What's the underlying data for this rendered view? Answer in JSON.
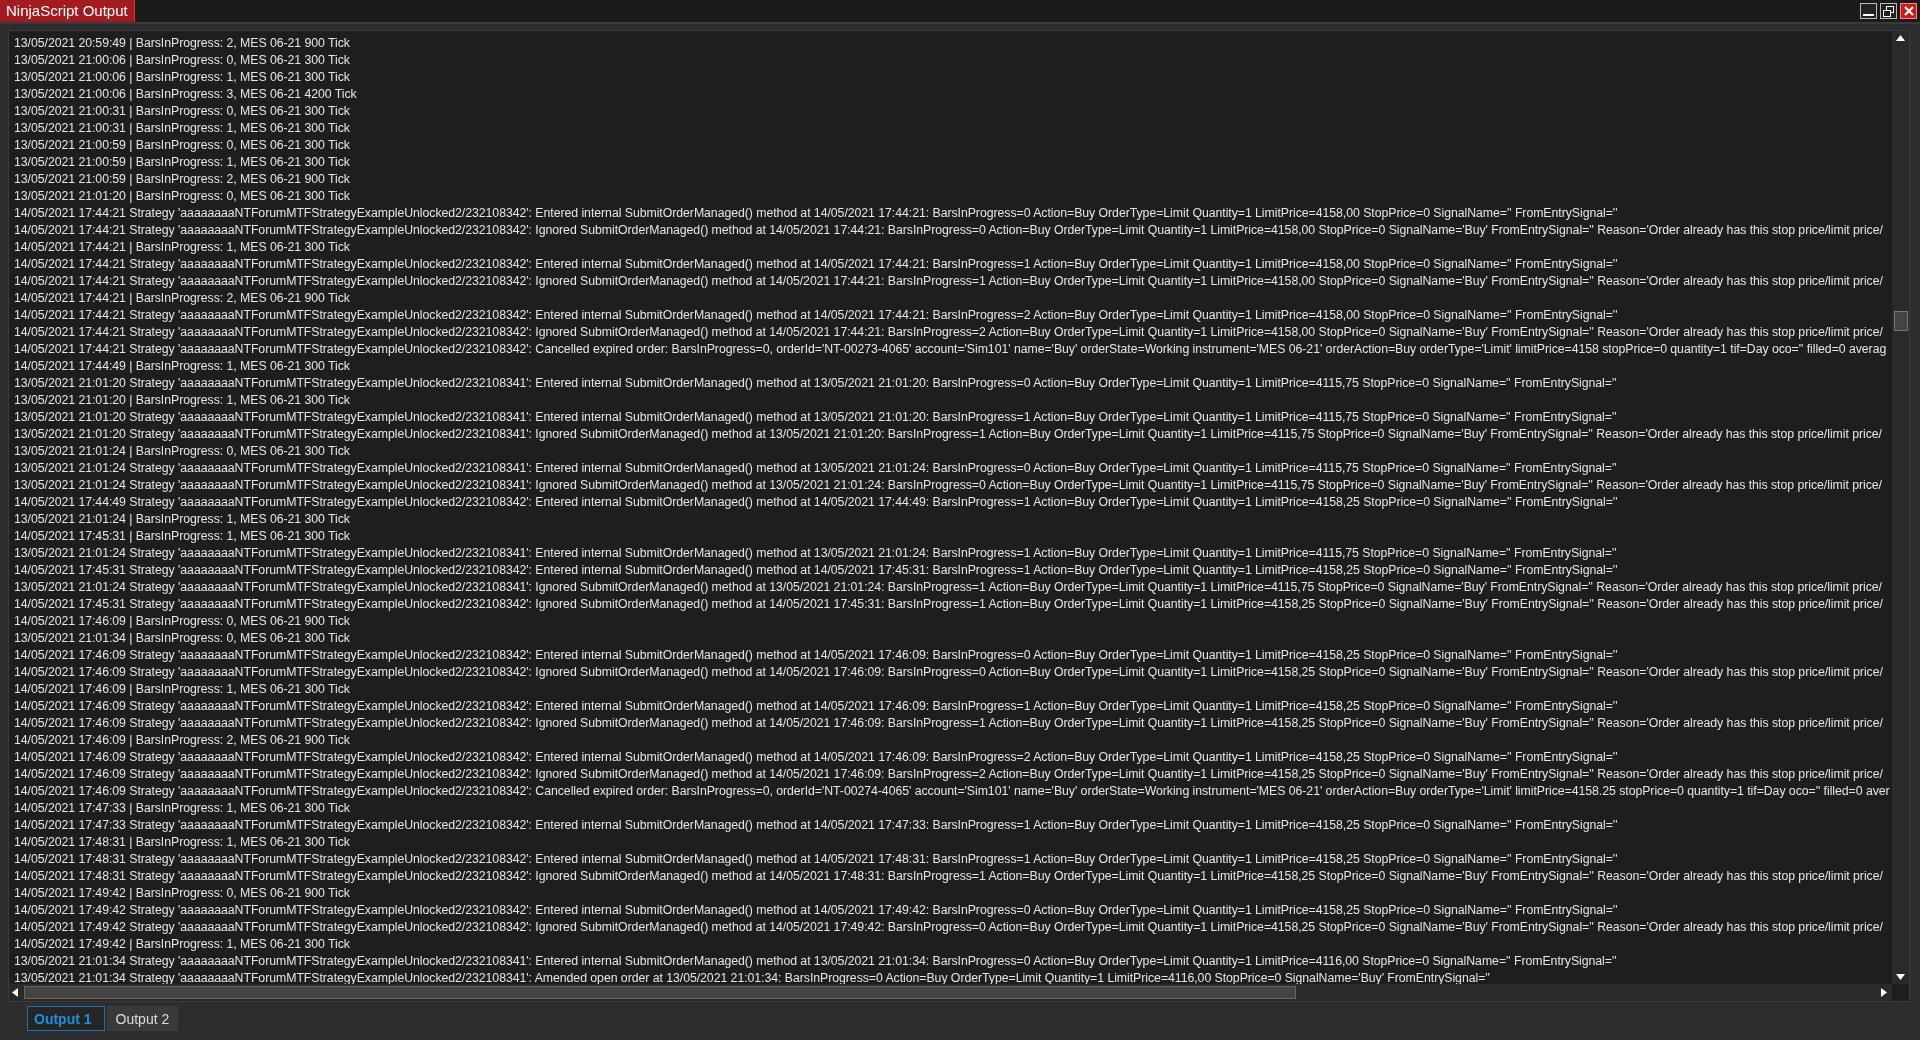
{
  "window": {
    "title": "NinjaScript Output"
  },
  "log": {
    "lines": [
      "13/05/2021 20:59:49 | BarsInProgress: 2, MES 06-21 900 Tick",
      "13/05/2021 21:00:06 | BarsInProgress: 0, MES 06-21 300 Tick",
      "13/05/2021 21:00:06 | BarsInProgress: 1, MES 06-21 300 Tick",
      "13/05/2021 21:00:06 | BarsInProgress: 3, MES 06-21 4200 Tick",
      "13/05/2021 21:00:31 | BarsInProgress: 0, MES 06-21 300 Tick",
      "13/05/2021 21:00:31 | BarsInProgress: 1, MES 06-21 300 Tick",
      "13/05/2021 21:00:59 | BarsInProgress: 0, MES 06-21 300 Tick",
      "13/05/2021 21:00:59 | BarsInProgress: 1, MES 06-21 300 Tick",
      "13/05/2021 21:00:59 | BarsInProgress: 2, MES 06-21 900 Tick",
      "13/05/2021 21:01:20 | BarsInProgress: 0, MES 06-21 300 Tick",
      "14/05/2021 17:44:21 Strategy 'aaaaaaaaNTForumMTFStrategyExampleUnlocked2/232108342': Entered internal SubmitOrderManaged() method at 14/05/2021 17:44:21: BarsInProgress=0 Action=Buy OrderType=Limit Quantity=1 LimitPrice=4158,00 StopPrice=0 SignalName='' FromEntrySignal=''",
      "14/05/2021 17:44:21 Strategy 'aaaaaaaaNTForumMTFStrategyExampleUnlocked2/232108342': Ignored SubmitOrderManaged() method at 14/05/2021 17:44:21: BarsInProgress=0 Action=Buy OrderType=Limit Quantity=1 LimitPrice=4158,00 StopPrice=0 SignalName='Buy' FromEntrySignal='' Reason='Order already has this stop price/limit price/",
      "14/05/2021 17:44:21 | BarsInProgress: 1, MES 06-21 300 Tick",
      "14/05/2021 17:44:21 Strategy 'aaaaaaaaNTForumMTFStrategyExampleUnlocked2/232108342': Entered internal SubmitOrderManaged() method at 14/05/2021 17:44:21: BarsInProgress=1 Action=Buy OrderType=Limit Quantity=1 LimitPrice=4158,00 StopPrice=0 SignalName='' FromEntrySignal=''",
      "14/05/2021 17:44:21 Strategy 'aaaaaaaaNTForumMTFStrategyExampleUnlocked2/232108342': Ignored SubmitOrderManaged() method at 14/05/2021 17:44:21: BarsInProgress=1 Action=Buy OrderType=Limit Quantity=1 LimitPrice=4158,00 StopPrice=0 SignalName='Buy' FromEntrySignal='' Reason='Order already has this stop price/limit price/",
      "14/05/2021 17:44:21 | BarsInProgress: 2, MES 06-21 900 Tick",
      "14/05/2021 17:44:21 Strategy 'aaaaaaaaNTForumMTFStrategyExampleUnlocked2/232108342': Entered internal SubmitOrderManaged() method at 14/05/2021 17:44:21: BarsInProgress=2 Action=Buy OrderType=Limit Quantity=1 LimitPrice=4158,00 StopPrice=0 SignalName='' FromEntrySignal=''",
      "14/05/2021 17:44:21 Strategy 'aaaaaaaaNTForumMTFStrategyExampleUnlocked2/232108342': Ignored SubmitOrderManaged() method at 14/05/2021 17:44:21: BarsInProgress=2 Action=Buy OrderType=Limit Quantity=1 LimitPrice=4158,00 StopPrice=0 SignalName='Buy' FromEntrySignal='' Reason='Order already has this stop price/limit price/",
      "14/05/2021 17:44:21 Strategy 'aaaaaaaaNTForumMTFStrategyExampleUnlocked2/232108342': Cancelled expired order: BarsInProgress=0, orderId='NT-00273-4065' account='Sim101' name='Buy' orderState=Working instrument='MES 06-21' orderAction=Buy orderType='Limit' limitPrice=4158 stopPrice=0 quantity=1 tif=Day oco='' filled=0 averag",
      "14/05/2021 17:44:49 | BarsInProgress: 1, MES 06-21 300 Tick",
      "13/05/2021 21:01:20 Strategy 'aaaaaaaaNTForumMTFStrategyExampleUnlocked2/232108341': Entered internal SubmitOrderManaged() method at 13/05/2021 21:01:20: BarsInProgress=0 Action=Buy OrderType=Limit Quantity=1 LimitPrice=4115,75 StopPrice=0 SignalName='' FromEntrySignal=''",
      "13/05/2021 21:01:20 | BarsInProgress: 1, MES 06-21 300 Tick",
      "13/05/2021 21:01:20 Strategy 'aaaaaaaaNTForumMTFStrategyExampleUnlocked2/232108341': Entered internal SubmitOrderManaged() method at 13/05/2021 21:01:20: BarsInProgress=1 Action=Buy OrderType=Limit Quantity=1 LimitPrice=4115,75 StopPrice=0 SignalName='' FromEntrySignal=''",
      "13/05/2021 21:01:20 Strategy 'aaaaaaaaNTForumMTFStrategyExampleUnlocked2/232108341': Ignored SubmitOrderManaged() method at 13/05/2021 21:01:20: BarsInProgress=1 Action=Buy OrderType=Limit Quantity=1 LimitPrice=4115,75 StopPrice=0 SignalName='Buy' FromEntrySignal='' Reason='Order already has this stop price/limit price/",
      "13/05/2021 21:01:24 | BarsInProgress: 0, MES 06-21 300 Tick",
      "13/05/2021 21:01:24 Strategy 'aaaaaaaaNTForumMTFStrategyExampleUnlocked2/232108341': Entered internal SubmitOrderManaged() method at 13/05/2021 21:01:24: BarsInProgress=0 Action=Buy OrderType=Limit Quantity=1 LimitPrice=4115,75 StopPrice=0 SignalName='' FromEntrySignal=''",
      "13/05/2021 21:01:24 Strategy 'aaaaaaaaNTForumMTFStrategyExampleUnlocked2/232108341': Ignored SubmitOrderManaged() method at 13/05/2021 21:01:24: BarsInProgress=0 Action=Buy OrderType=Limit Quantity=1 LimitPrice=4115,75 StopPrice=0 SignalName='Buy' FromEntrySignal='' Reason='Order already has this stop price/limit price/",
      "14/05/2021 17:44:49 Strategy 'aaaaaaaaNTForumMTFStrategyExampleUnlocked2/232108342': Entered internal SubmitOrderManaged() method at 14/05/2021 17:44:49: BarsInProgress=1 Action=Buy OrderType=Limit Quantity=1 LimitPrice=4158,25 StopPrice=0 SignalName='' FromEntrySignal=''",
      "13/05/2021 21:01:24 | BarsInProgress: 1, MES 06-21 300 Tick",
      "14/05/2021 17:45:31 | BarsInProgress: 1, MES 06-21 300 Tick",
      "13/05/2021 21:01:24 Strategy 'aaaaaaaaNTForumMTFStrategyExampleUnlocked2/232108341': Entered internal SubmitOrderManaged() method at 13/05/2021 21:01:24: BarsInProgress=1 Action=Buy OrderType=Limit Quantity=1 LimitPrice=4115,75 StopPrice=0 SignalName='' FromEntrySignal=''",
      "14/05/2021 17:45:31 Strategy 'aaaaaaaaNTForumMTFStrategyExampleUnlocked2/232108342': Entered internal SubmitOrderManaged() method at 14/05/2021 17:45:31: BarsInProgress=1 Action=Buy OrderType=Limit Quantity=1 LimitPrice=4158,25 StopPrice=0 SignalName='' FromEntrySignal=''",
      "13/05/2021 21:01:24 Strategy 'aaaaaaaaNTForumMTFStrategyExampleUnlocked2/232108341': Ignored SubmitOrderManaged() method at 13/05/2021 21:01:24: BarsInProgress=1 Action=Buy OrderType=Limit Quantity=1 LimitPrice=4115,75 StopPrice=0 SignalName='Buy' FromEntrySignal='' Reason='Order already has this stop price/limit price/",
      "14/05/2021 17:45:31 Strategy 'aaaaaaaaNTForumMTFStrategyExampleUnlocked2/232108342': Ignored SubmitOrderManaged() method at 14/05/2021 17:45:31: BarsInProgress=1 Action=Buy OrderType=Limit Quantity=1 LimitPrice=4158,25 StopPrice=0 SignalName='Buy' FromEntrySignal='' Reason='Order already has this stop price/limit price/",
      "14/05/2021 17:46:09 | BarsInProgress: 0, MES 06-21 900 Tick",
      "13/05/2021 21:01:34 | BarsInProgress: 0, MES 06-21 300 Tick",
      "14/05/2021 17:46:09 Strategy 'aaaaaaaaNTForumMTFStrategyExampleUnlocked2/232108342': Entered internal SubmitOrderManaged() method at 14/05/2021 17:46:09: BarsInProgress=0 Action=Buy OrderType=Limit Quantity=1 LimitPrice=4158,25 StopPrice=0 SignalName='' FromEntrySignal=''",
      "14/05/2021 17:46:09 Strategy 'aaaaaaaaNTForumMTFStrategyExampleUnlocked2/232108342': Ignored SubmitOrderManaged() method at 14/05/2021 17:46:09: BarsInProgress=0 Action=Buy OrderType=Limit Quantity=1 LimitPrice=4158,25 StopPrice=0 SignalName='Buy' FromEntrySignal='' Reason='Order already has this stop price/limit price/",
      "14/05/2021 17:46:09 | BarsInProgress: 1, MES 06-21 300 Tick",
      "14/05/2021 17:46:09 Strategy 'aaaaaaaaNTForumMTFStrategyExampleUnlocked2/232108342': Entered internal SubmitOrderManaged() method at 14/05/2021 17:46:09: BarsInProgress=1 Action=Buy OrderType=Limit Quantity=1 LimitPrice=4158,25 StopPrice=0 SignalName='' FromEntrySignal=''",
      "14/05/2021 17:46:09 Strategy 'aaaaaaaaNTForumMTFStrategyExampleUnlocked2/232108342': Ignored SubmitOrderManaged() method at 14/05/2021 17:46:09: BarsInProgress=1 Action=Buy OrderType=Limit Quantity=1 LimitPrice=4158,25 StopPrice=0 SignalName='Buy' FromEntrySignal='' Reason='Order already has this stop price/limit price/",
      "14/05/2021 17:46:09 | BarsInProgress: 2, MES 06-21 900 Tick",
      "14/05/2021 17:46:09 Strategy 'aaaaaaaaNTForumMTFStrategyExampleUnlocked2/232108342': Entered internal SubmitOrderManaged() method at 14/05/2021 17:46:09: BarsInProgress=2 Action=Buy OrderType=Limit Quantity=1 LimitPrice=4158,25 StopPrice=0 SignalName='' FromEntrySignal=''",
      "14/05/2021 17:46:09 Strategy 'aaaaaaaaNTForumMTFStrategyExampleUnlocked2/232108342': Ignored SubmitOrderManaged() method at 14/05/2021 17:46:09: BarsInProgress=2 Action=Buy OrderType=Limit Quantity=1 LimitPrice=4158,25 StopPrice=0 SignalName='Buy' FromEntrySignal='' Reason='Order already has this stop price/limit price/",
      "14/05/2021 17:46:09 Strategy 'aaaaaaaaNTForumMTFStrategyExampleUnlocked2/232108342': Cancelled expired order: BarsInProgress=0, orderId='NT-00274-4065' account='Sim101' name='Buy' orderState=Working instrument='MES 06-21' orderAction=Buy orderType='Limit' limitPrice=4158.25 stopPrice=0 quantity=1 tif=Day oco='' filled=0 aver",
      "14/05/2021 17:47:33 | BarsInProgress: 1, MES 06-21 300 Tick",
      "14/05/2021 17:47:33 Strategy 'aaaaaaaaNTForumMTFStrategyExampleUnlocked2/232108342': Entered internal SubmitOrderManaged() method at 14/05/2021 17:47:33: BarsInProgress=1 Action=Buy OrderType=Limit Quantity=1 LimitPrice=4158,25 StopPrice=0 SignalName='' FromEntrySignal=''",
      "14/05/2021 17:48:31 | BarsInProgress: 1, MES 06-21 300 Tick",
      "14/05/2021 17:48:31 Strategy 'aaaaaaaaNTForumMTFStrategyExampleUnlocked2/232108342': Entered internal SubmitOrderManaged() method at 14/05/2021 17:48:31: BarsInProgress=1 Action=Buy OrderType=Limit Quantity=1 LimitPrice=4158,25 StopPrice=0 SignalName='' FromEntrySignal=''",
      "14/05/2021 17:48:31 Strategy 'aaaaaaaaNTForumMTFStrategyExampleUnlocked2/232108342': Ignored SubmitOrderManaged() method at 14/05/2021 17:48:31: BarsInProgress=1 Action=Buy OrderType=Limit Quantity=1 LimitPrice=4158,25 StopPrice=0 SignalName='Buy' FromEntrySignal='' Reason='Order already has this stop price/limit price/",
      "14/05/2021 17:49:42 | BarsInProgress: 0, MES 06-21 900 Tick",
      "14/05/2021 17:49:42 Strategy 'aaaaaaaaNTForumMTFStrategyExampleUnlocked2/232108342': Entered internal SubmitOrderManaged() method at 14/05/2021 17:49:42: BarsInProgress=0 Action=Buy OrderType=Limit Quantity=1 LimitPrice=4158,25 StopPrice=0 SignalName='' FromEntrySignal=''",
      "14/05/2021 17:49:42 Strategy 'aaaaaaaaNTForumMTFStrategyExampleUnlocked2/232108342': Ignored SubmitOrderManaged() method at 14/05/2021 17:49:42: BarsInProgress=0 Action=Buy OrderType=Limit Quantity=1 LimitPrice=4158,25 StopPrice=0 SignalName='Buy' FromEntrySignal='' Reason='Order already has this stop price/limit price/",
      "14/05/2021 17:49:42 | BarsInProgress: 1, MES 06-21 300 Tick",
      "13/05/2021 21:01:34 Strategy 'aaaaaaaaNTForumMTFStrategyExampleUnlocked2/232108341': Entered internal SubmitOrderManaged() method at 13/05/2021 21:01:34: BarsInProgress=0 Action=Buy OrderType=Limit Quantity=1 LimitPrice=4116,00 StopPrice=0 SignalName='' FromEntrySignal=''",
      "13/05/2021 21:01:34 Strategy 'aaaaaaaaNTForumMTFStrategyExampleUnlocked2/232108341': Amended open order at 13/05/2021 21:01:34: BarsInProgress=0 Action=Buy OrderType=Limit Quantity=1 LimitPrice=4116,00 StopPrice=0 SignalName='Buy' FromEntrySignal=''"
    ]
  },
  "tabs": [
    {
      "label": "Output 1",
      "selected": true
    },
    {
      "label": "Output 2",
      "selected": false
    }
  ]
}
